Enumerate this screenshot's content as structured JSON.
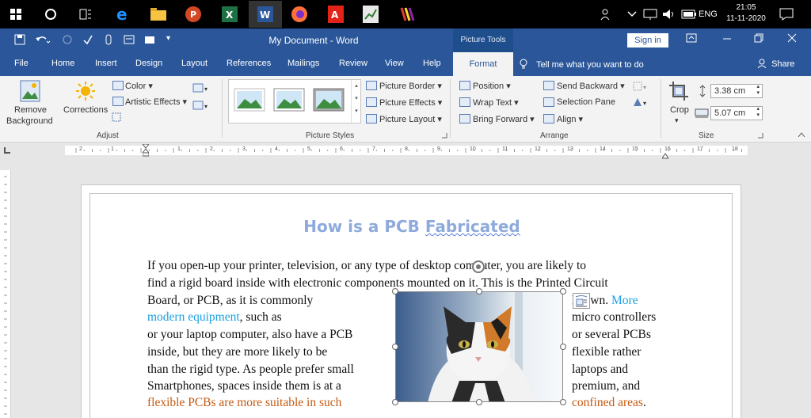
{
  "taskbar": {
    "icons": [
      "windows-start-icon",
      "cortana-icon",
      "task-view-icon",
      "edge-icon",
      "file-explorer-icon",
      "powerpoint-icon",
      "excel-icon",
      "word-icon",
      "firefox-icon",
      "acrobat-icon",
      "finance-icon",
      "winrar-icon"
    ],
    "ime": "ENG",
    "time": "21:05",
    "date": "11-11-2020"
  },
  "title_bar": {
    "document_title": "My Document - Word",
    "context_title": "Picture Tools",
    "signin_label": "Sign in"
  },
  "tabs": [
    "File",
    "Home",
    "Insert",
    "Design",
    "Layout",
    "References",
    "Mailings",
    "Review",
    "View",
    "Help"
  ],
  "active_tab": "Format",
  "tell_me": "Tell me what you want to do",
  "share_label": "Share",
  "ribbon": {
    "adjust": {
      "remove_bg_line1": "Remove",
      "remove_bg_line2": "Background",
      "corrections": "Corrections",
      "color": "Color",
      "artistic_effects": "Artistic Effects",
      "group_label": "Adjust"
    },
    "picture_styles": {
      "border": "Picture Border",
      "effects": "Picture Effects",
      "layout": "Picture Layout",
      "group_label": "Picture Styles"
    },
    "arrange": {
      "position": "Position",
      "wrap_text": "Wrap Text",
      "bring_forward": "Bring Forward",
      "send_backward": "Send Backward",
      "selection_pane": "Selection Pane",
      "align": "Align",
      "group_label": "Arrange"
    },
    "size": {
      "crop": "Crop",
      "height": "3.38 cm",
      "width": "5.07 cm",
      "group_label": "Size"
    }
  },
  "ruler_numbers": [
    "2",
    "1",
    "1",
    "2",
    "3",
    "4",
    "5",
    "6",
    "7",
    "8",
    "9",
    "10",
    "11",
    "12",
    "13",
    "14",
    "15",
    "16",
    "17",
    "18"
  ],
  "document": {
    "heading_part1": "How is a PCB ",
    "heading_part2": "Fabricated",
    "line1": "If you open-up your printer, television, or any type of desktop computer, you are likely to",
    "line2": "find a rigid board inside with electronic components mounted on it. This is the Printed Circuit",
    "line3_left": "Board, or PCB, as it is commonly",
    "line3_right_a": "known. ",
    "line3_right_b": "More",
    "line4_left_a": "modern equipment",
    "line4_left_b": ", such as",
    "line4_right": "micro controllers",
    "line5_left": "or your laptop computer, also have a PCB",
    "line5_right": "or several PCBs",
    "line6_left": "inside, but they are more likely to be",
    "line6_right": "flexible rather",
    "line7_left": "than the rigid type. As people prefer small",
    "line7_right": "laptops and",
    "line8_left": "Smartphones, spaces inside them is at a",
    "line8_right": "premium, and",
    "line9_left": "flexible PCBs are more suitable in such",
    "line9_right_a": "confined areas",
    "line9_right_b": "."
  }
}
